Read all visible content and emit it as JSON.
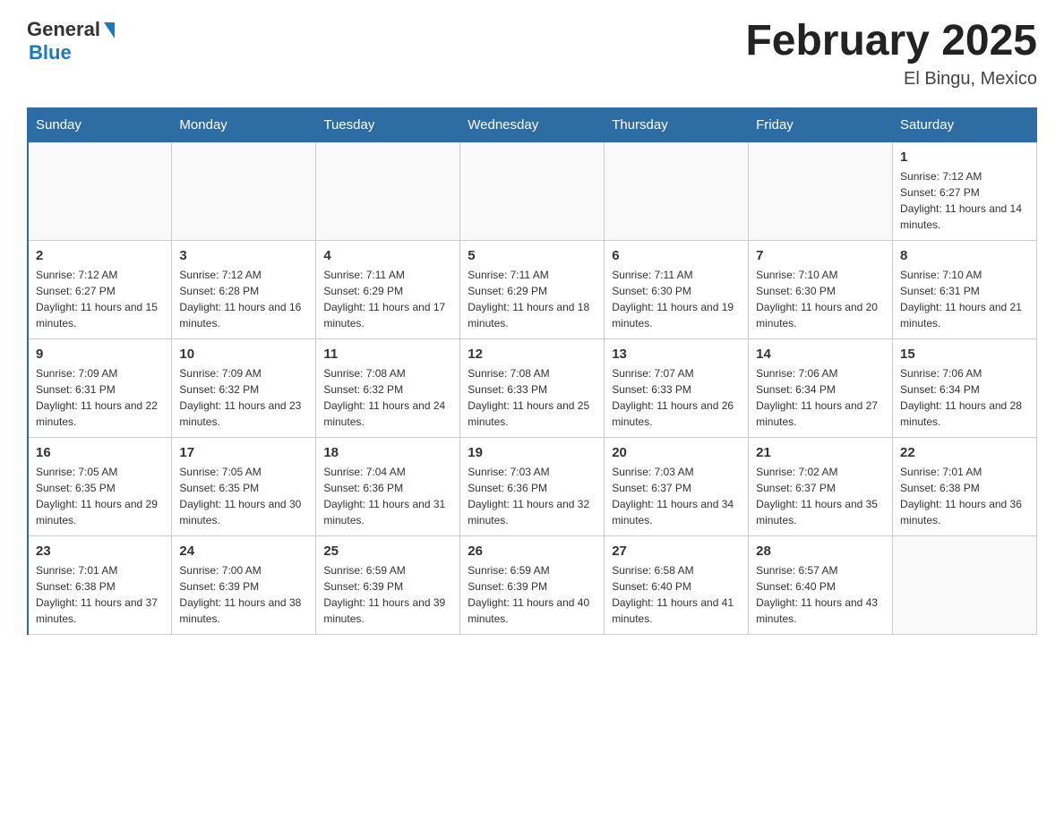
{
  "header": {
    "logo": {
      "general": "General",
      "blue": "Blue"
    },
    "title": "February 2025",
    "location": "El Bingu, Mexico"
  },
  "weekdays": [
    "Sunday",
    "Monday",
    "Tuesday",
    "Wednesday",
    "Thursday",
    "Friday",
    "Saturday"
  ],
  "weeks": [
    [
      {
        "day": "",
        "info": ""
      },
      {
        "day": "",
        "info": ""
      },
      {
        "day": "",
        "info": ""
      },
      {
        "day": "",
        "info": ""
      },
      {
        "day": "",
        "info": ""
      },
      {
        "day": "",
        "info": ""
      },
      {
        "day": "1",
        "info": "Sunrise: 7:12 AM\nSunset: 6:27 PM\nDaylight: 11 hours and 14 minutes."
      }
    ],
    [
      {
        "day": "2",
        "info": "Sunrise: 7:12 AM\nSunset: 6:27 PM\nDaylight: 11 hours and 15 minutes."
      },
      {
        "day": "3",
        "info": "Sunrise: 7:12 AM\nSunset: 6:28 PM\nDaylight: 11 hours and 16 minutes."
      },
      {
        "day": "4",
        "info": "Sunrise: 7:11 AM\nSunset: 6:29 PM\nDaylight: 11 hours and 17 minutes."
      },
      {
        "day": "5",
        "info": "Sunrise: 7:11 AM\nSunset: 6:29 PM\nDaylight: 11 hours and 18 minutes."
      },
      {
        "day": "6",
        "info": "Sunrise: 7:11 AM\nSunset: 6:30 PM\nDaylight: 11 hours and 19 minutes."
      },
      {
        "day": "7",
        "info": "Sunrise: 7:10 AM\nSunset: 6:30 PM\nDaylight: 11 hours and 20 minutes."
      },
      {
        "day": "8",
        "info": "Sunrise: 7:10 AM\nSunset: 6:31 PM\nDaylight: 11 hours and 21 minutes."
      }
    ],
    [
      {
        "day": "9",
        "info": "Sunrise: 7:09 AM\nSunset: 6:31 PM\nDaylight: 11 hours and 22 minutes."
      },
      {
        "day": "10",
        "info": "Sunrise: 7:09 AM\nSunset: 6:32 PM\nDaylight: 11 hours and 23 minutes."
      },
      {
        "day": "11",
        "info": "Sunrise: 7:08 AM\nSunset: 6:32 PM\nDaylight: 11 hours and 24 minutes."
      },
      {
        "day": "12",
        "info": "Sunrise: 7:08 AM\nSunset: 6:33 PM\nDaylight: 11 hours and 25 minutes."
      },
      {
        "day": "13",
        "info": "Sunrise: 7:07 AM\nSunset: 6:33 PM\nDaylight: 11 hours and 26 minutes."
      },
      {
        "day": "14",
        "info": "Sunrise: 7:06 AM\nSunset: 6:34 PM\nDaylight: 11 hours and 27 minutes."
      },
      {
        "day": "15",
        "info": "Sunrise: 7:06 AM\nSunset: 6:34 PM\nDaylight: 11 hours and 28 minutes."
      }
    ],
    [
      {
        "day": "16",
        "info": "Sunrise: 7:05 AM\nSunset: 6:35 PM\nDaylight: 11 hours and 29 minutes."
      },
      {
        "day": "17",
        "info": "Sunrise: 7:05 AM\nSunset: 6:35 PM\nDaylight: 11 hours and 30 minutes."
      },
      {
        "day": "18",
        "info": "Sunrise: 7:04 AM\nSunset: 6:36 PM\nDaylight: 11 hours and 31 minutes."
      },
      {
        "day": "19",
        "info": "Sunrise: 7:03 AM\nSunset: 6:36 PM\nDaylight: 11 hours and 32 minutes."
      },
      {
        "day": "20",
        "info": "Sunrise: 7:03 AM\nSunset: 6:37 PM\nDaylight: 11 hours and 34 minutes."
      },
      {
        "day": "21",
        "info": "Sunrise: 7:02 AM\nSunset: 6:37 PM\nDaylight: 11 hours and 35 minutes."
      },
      {
        "day": "22",
        "info": "Sunrise: 7:01 AM\nSunset: 6:38 PM\nDaylight: 11 hours and 36 minutes."
      }
    ],
    [
      {
        "day": "23",
        "info": "Sunrise: 7:01 AM\nSunset: 6:38 PM\nDaylight: 11 hours and 37 minutes."
      },
      {
        "day": "24",
        "info": "Sunrise: 7:00 AM\nSunset: 6:39 PM\nDaylight: 11 hours and 38 minutes."
      },
      {
        "day": "25",
        "info": "Sunrise: 6:59 AM\nSunset: 6:39 PM\nDaylight: 11 hours and 39 minutes."
      },
      {
        "day": "26",
        "info": "Sunrise: 6:59 AM\nSunset: 6:39 PM\nDaylight: 11 hours and 40 minutes."
      },
      {
        "day": "27",
        "info": "Sunrise: 6:58 AM\nSunset: 6:40 PM\nDaylight: 11 hours and 41 minutes."
      },
      {
        "day": "28",
        "info": "Sunrise: 6:57 AM\nSunset: 6:40 PM\nDaylight: 11 hours and 43 minutes."
      },
      {
        "day": "",
        "info": ""
      }
    ]
  ]
}
